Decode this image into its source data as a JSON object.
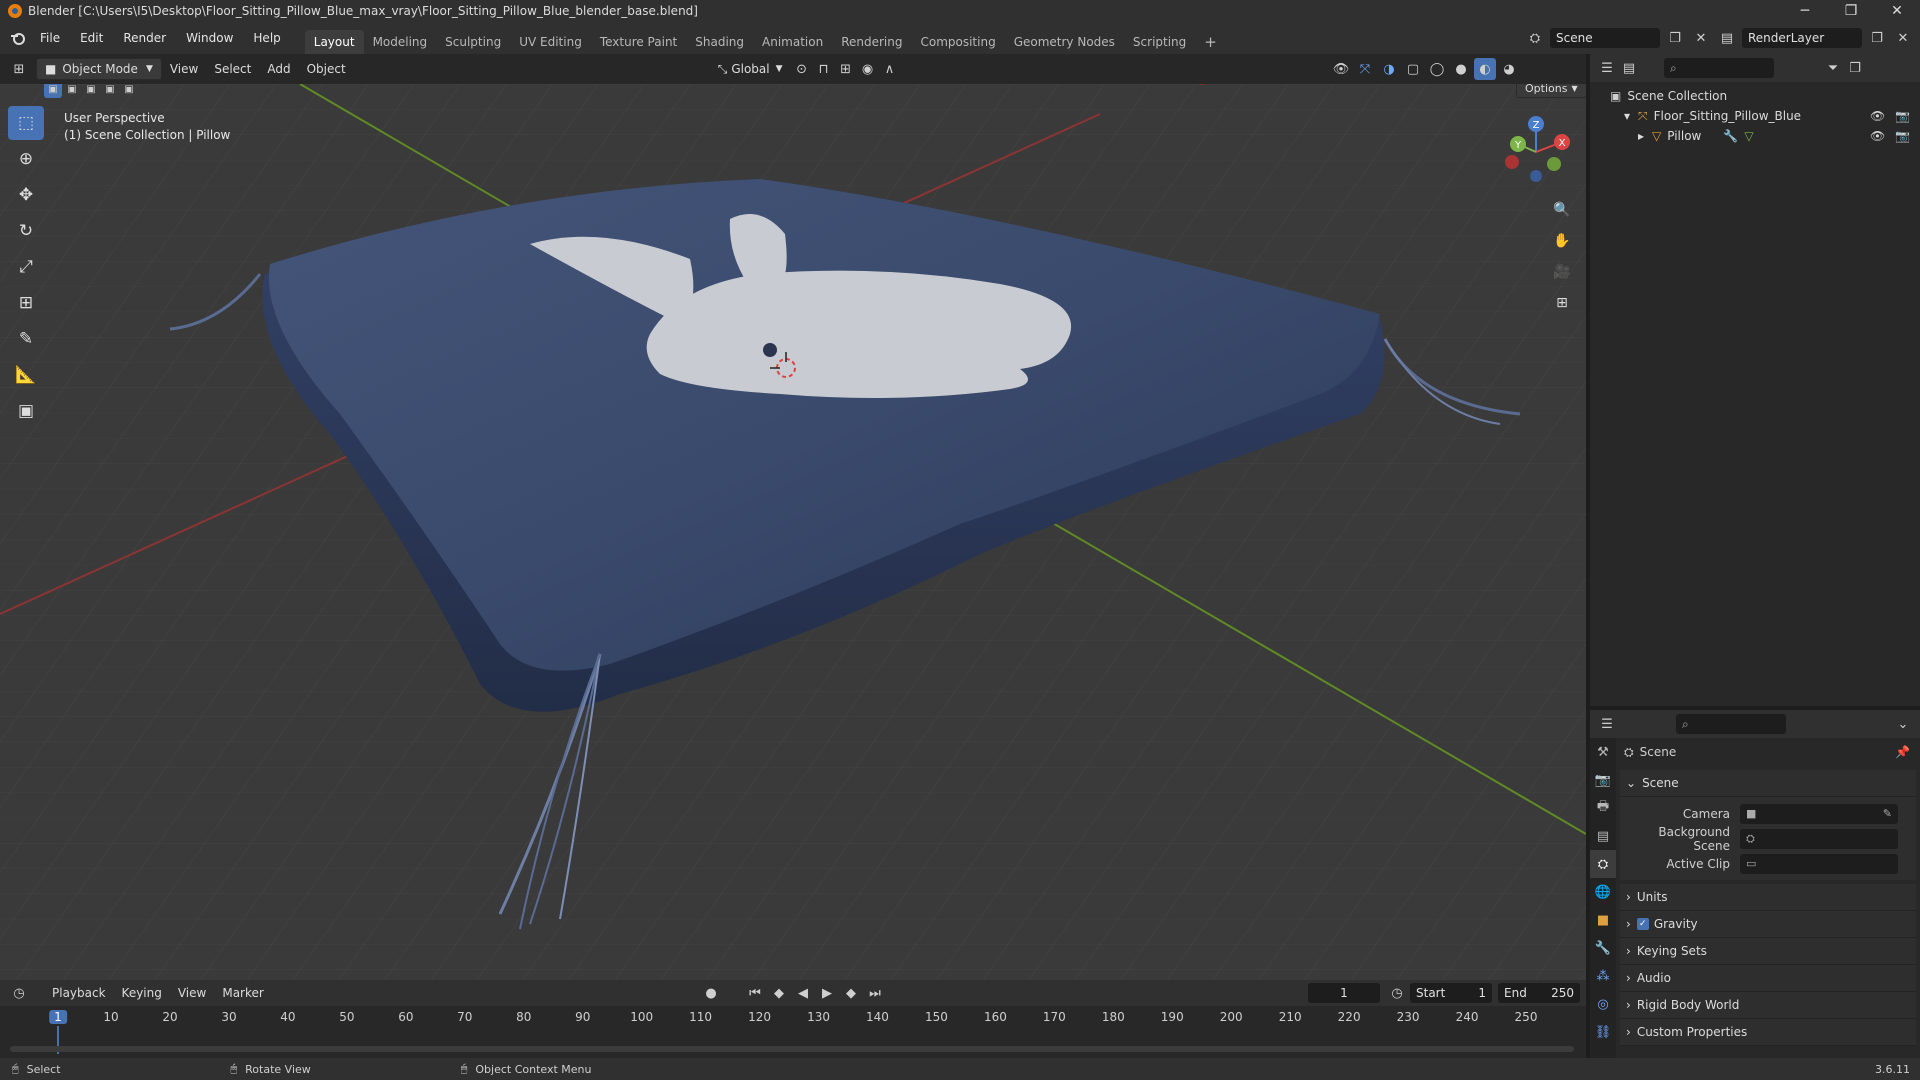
{
  "window": {
    "title": "Blender [C:\\Users\\I5\\Desktop\\Floor_Sitting_Pillow_Blue_max_vray\\Floor_Sitting_Pillow_Blue_blender_base.blend]",
    "minimize": "─",
    "maximize": "❐",
    "close": "✕"
  },
  "menu": [
    "File",
    "Edit",
    "Render",
    "Window",
    "Help"
  ],
  "workspaces": [
    "Layout",
    "Modeling",
    "Sculpting",
    "UV Editing",
    "Texture Paint",
    "Shading",
    "Animation",
    "Rendering",
    "Compositing",
    "Geometry Nodes",
    "Scripting"
  ],
  "active_workspace": "Layout",
  "add_workspace": "+",
  "scene_selector": {
    "scene": "Scene",
    "view_layer": "RenderLayer"
  },
  "viewport_header": {
    "mode": "Object Mode",
    "menus": [
      "View",
      "Select",
      "Add",
      "Object"
    ],
    "orientation": "Global",
    "options": "Options"
  },
  "viewport": {
    "perspective": "User Perspective",
    "collection_info": "(1) Scene Collection | Pillow",
    "axis_labels": {
      "x": "X",
      "y": "Y",
      "z": "Z"
    }
  },
  "outliner": {
    "search_placeholder": "",
    "root": "Scene Collection",
    "items": [
      {
        "label": "Floor_Sitting_Pillow_Blue",
        "expanded": "▾"
      },
      {
        "label": "Pillow",
        "expanded": "▸"
      }
    ]
  },
  "properties": {
    "title": "Scene",
    "section": "Scene",
    "fields": [
      {
        "label": "Camera",
        "value": ""
      },
      {
        "label": "Background Scene",
        "value": ""
      },
      {
        "label": "Active Clip",
        "value": ""
      }
    ],
    "panels": [
      "Units",
      "Gravity",
      "Keying Sets",
      "Audio",
      "Rigid Body World",
      "Custom Properties"
    ],
    "gravity_checked": true
  },
  "timeline": {
    "menus": [
      "Playback",
      "Keying",
      "View",
      "Marker"
    ],
    "current_frame": "1",
    "start_label": "Start",
    "start": "1",
    "end_label": "End",
    "end": "250",
    "ticks": [
      "1",
      "10",
      "20",
      "30",
      "40",
      "50",
      "60",
      "70",
      "80",
      "90",
      "100",
      "110",
      "120",
      "130",
      "140",
      "150",
      "160",
      "170",
      "180",
      "190",
      "200",
      "210",
      "220",
      "230",
      "240",
      "250"
    ]
  },
  "statusbar": {
    "hints": [
      "Select",
      "Rotate View",
      "Object Context Menu"
    ],
    "version": "3.6.11"
  },
  "colors": {
    "accent": "#4772b3",
    "pillow": "#3b4a6b",
    "bunny": "#c8cbd1",
    "x_axis": "#9b3b3b",
    "y_axis": "#6a8f2a"
  }
}
